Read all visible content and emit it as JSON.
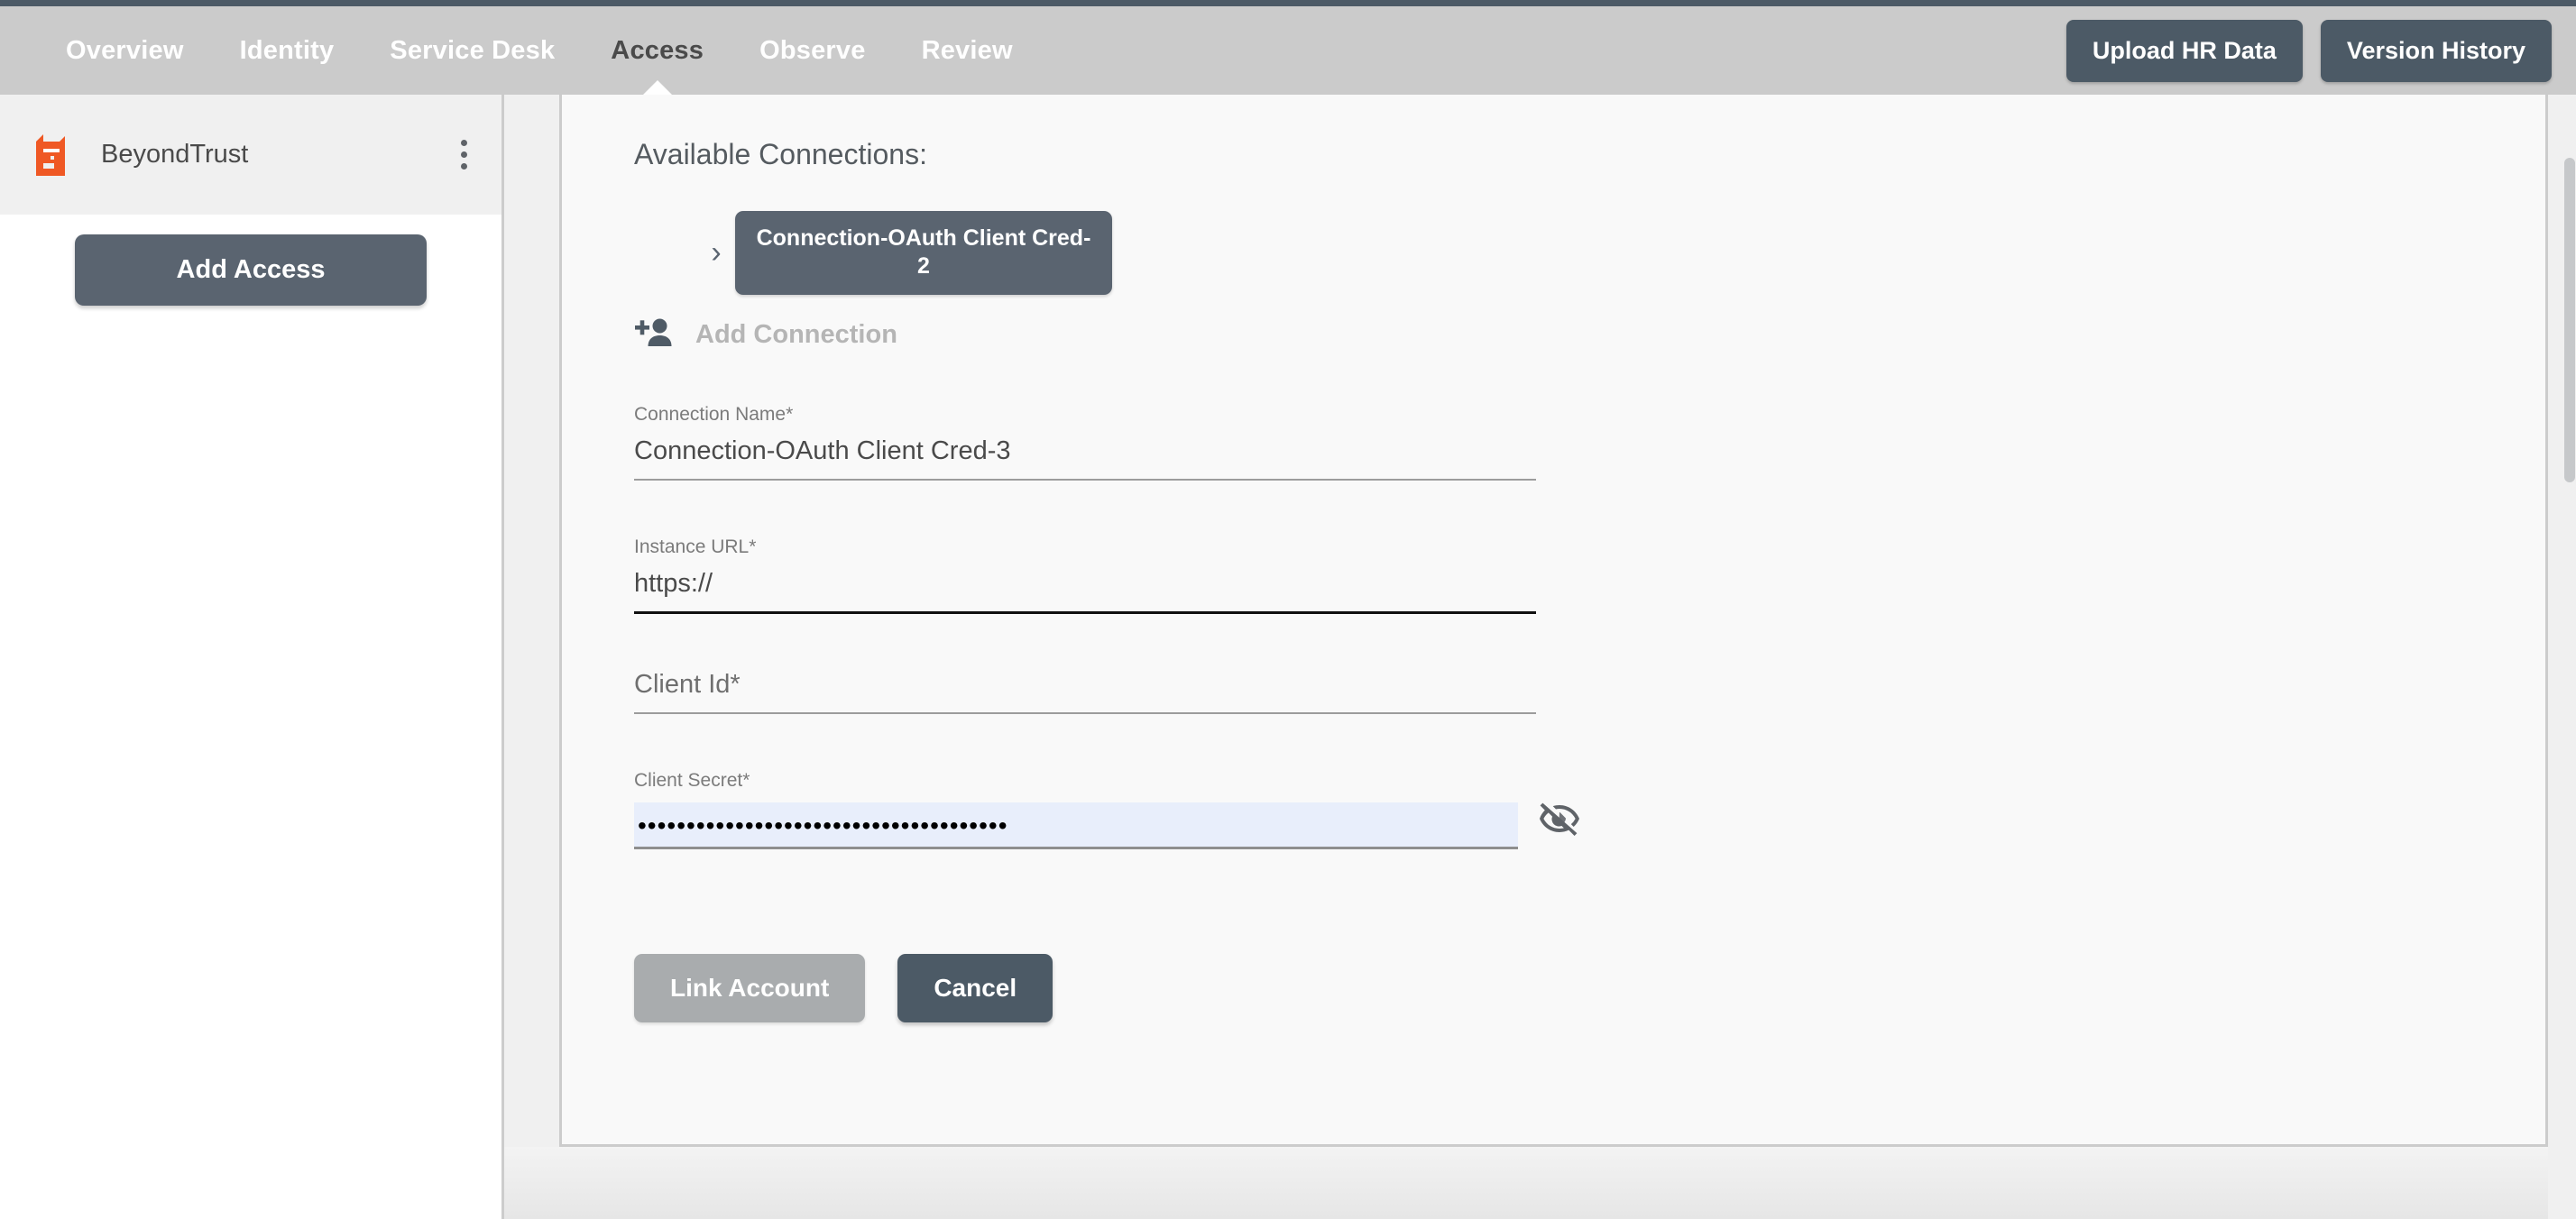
{
  "topnav": {
    "tabs": [
      {
        "label": "Overview",
        "active": false
      },
      {
        "label": "Identity",
        "active": false
      },
      {
        "label": "Service Desk",
        "active": false
      },
      {
        "label": "Access",
        "active": true
      },
      {
        "label": "Observe",
        "active": false
      },
      {
        "label": "Review",
        "active": false
      }
    ],
    "upload_hr_data_label": "Upload HR Data",
    "version_history_label": "Version History"
  },
  "sidebar": {
    "org_name": "BeyondTrust",
    "logo_icon": "beyondtrust-logo-icon",
    "menu_icon": "kebab-menu-icon",
    "add_access_label": "Add Access"
  },
  "main": {
    "section_title": "Available Connections:",
    "expand_icon": "chevron-right-icon",
    "connection_pill_label": "Connection-OAuth Client Cred-2",
    "add_connection": {
      "icon": "person-add-icon",
      "label": "Add Connection"
    },
    "fields": [
      {
        "name": "connection-name",
        "label": "Connection Name*",
        "value": "Connection-OAuth Client Cred-3",
        "focused": false
      },
      {
        "name": "instance-url",
        "label": "Instance URL*",
        "value": "https://",
        "focused": true
      }
    ],
    "client_id": {
      "name": "client-id",
      "placeholder": "Client Id*"
    },
    "client_secret": {
      "name": "client-secret",
      "label": "Client Secret*",
      "value": "••••••••••••••••••••••••••••••••••••••",
      "toggle_icon": "eye-off-icon"
    },
    "actions": {
      "link_account_label": "Link Account",
      "cancel_label": "Cancel"
    }
  },
  "colors": {
    "nav_bar": "#cbcbcb",
    "slate": "#4c5a66",
    "slate_light": "#5a6470",
    "brand_orange": "#ef5824",
    "disabled_gray": "#a9acae",
    "autofill_blue": "#e8eefb"
  }
}
